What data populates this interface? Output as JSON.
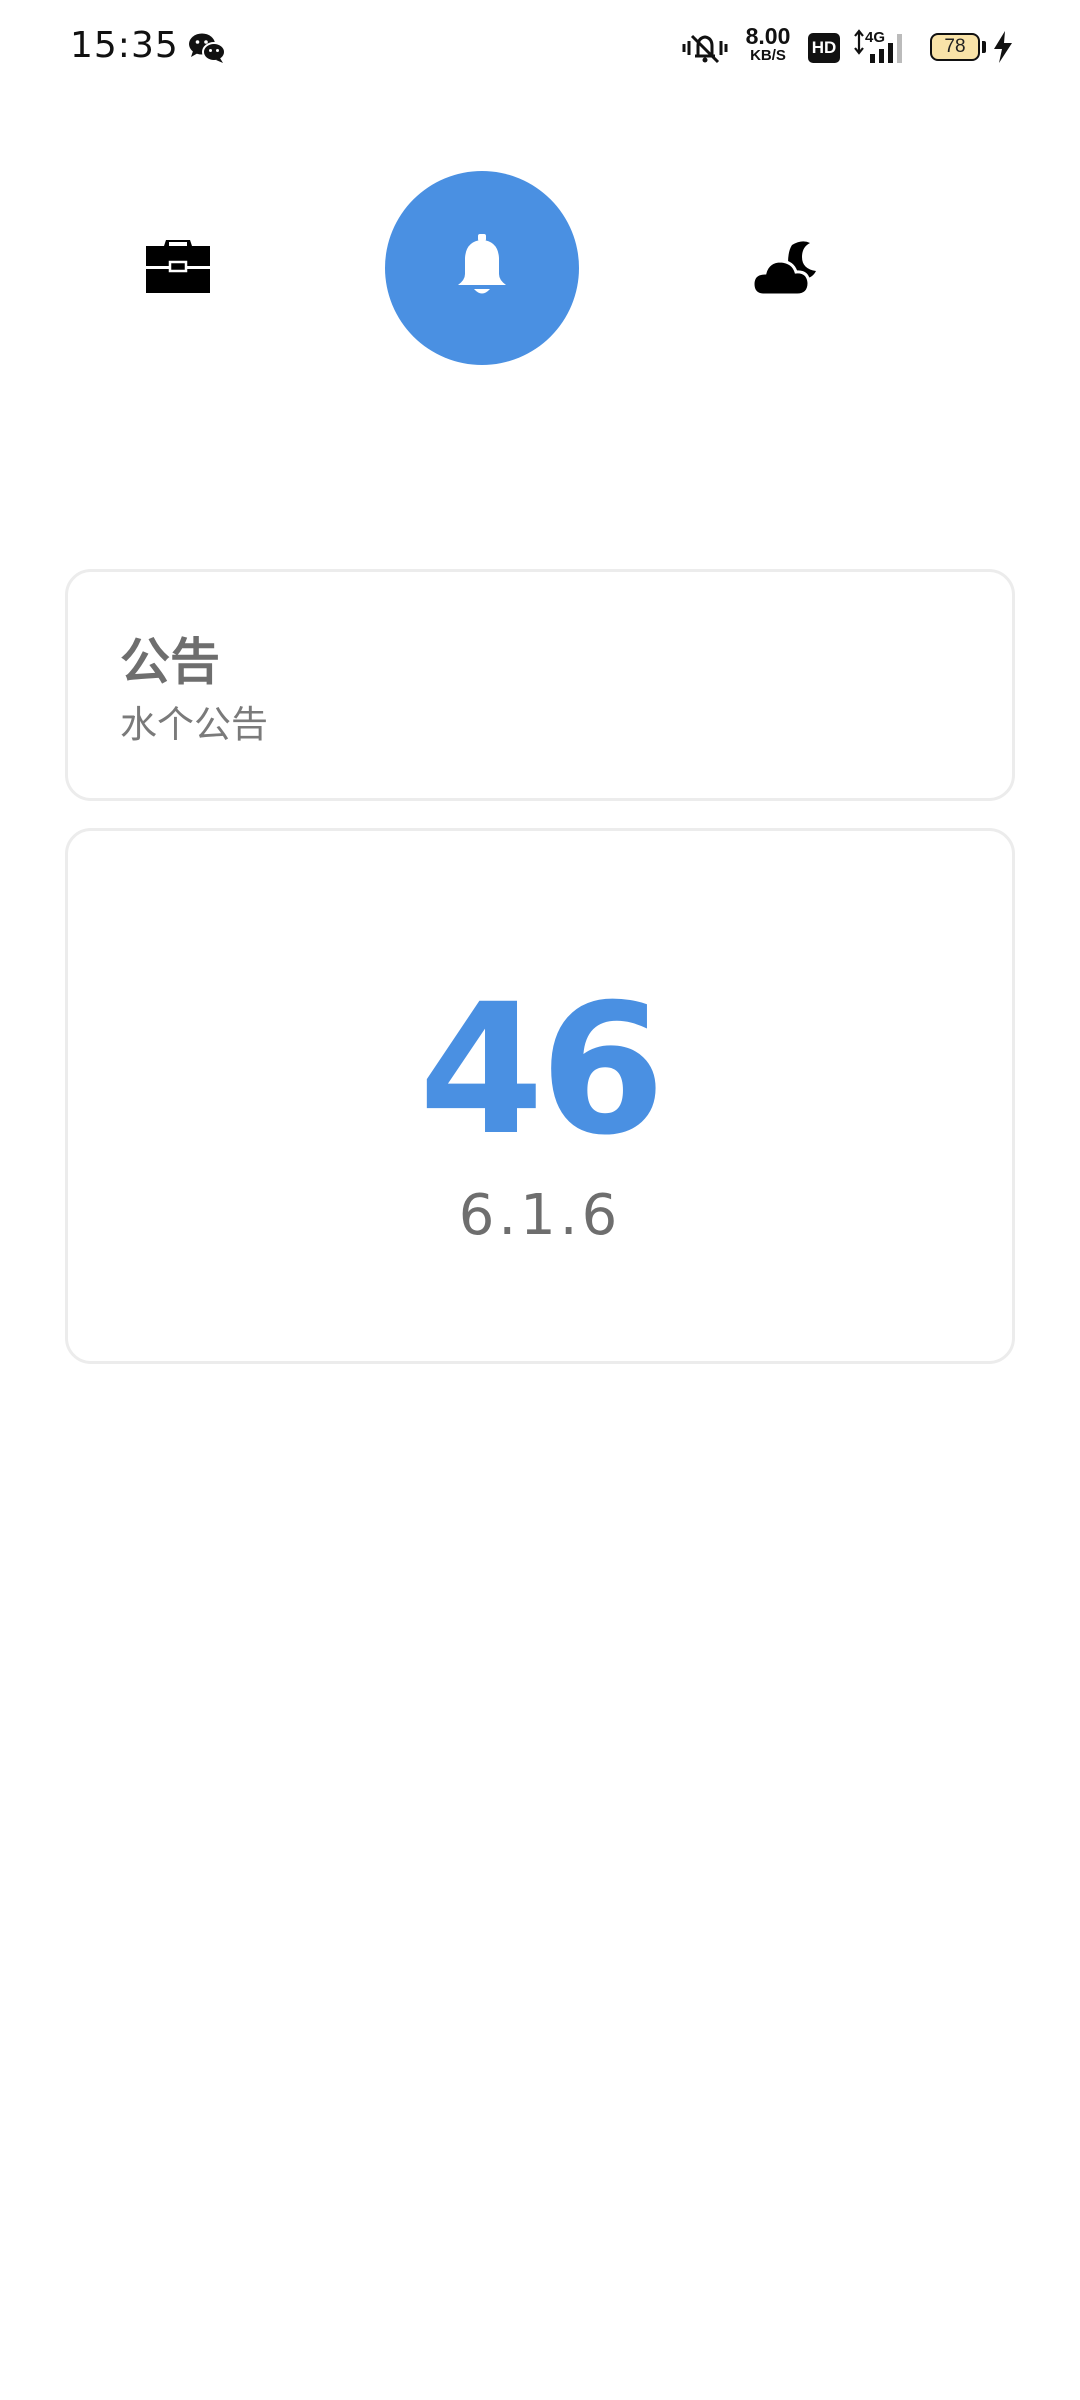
{
  "status_bar": {
    "time": "15:35",
    "net_speed_value": "8.00",
    "net_speed_unit": "KB/S",
    "hd_label": "HD",
    "network_type": "4G",
    "battery_level": "78",
    "icons": [
      "wechat-icon",
      "mute-icon",
      "signal-icon",
      "charging-icon"
    ]
  },
  "nav": {
    "items": [
      {
        "name": "toolbox",
        "icon": "briefcase-icon",
        "active": false
      },
      {
        "name": "notice",
        "icon": "bell-icon",
        "active": true
      },
      {
        "name": "night",
        "icon": "cloud-moon-icon",
        "active": false
      }
    ],
    "accent_color": "#4a90e2"
  },
  "notice_card": {
    "title": "公告",
    "body": "水个公告"
  },
  "count_card": {
    "number": "46",
    "version": "6.1.6"
  }
}
